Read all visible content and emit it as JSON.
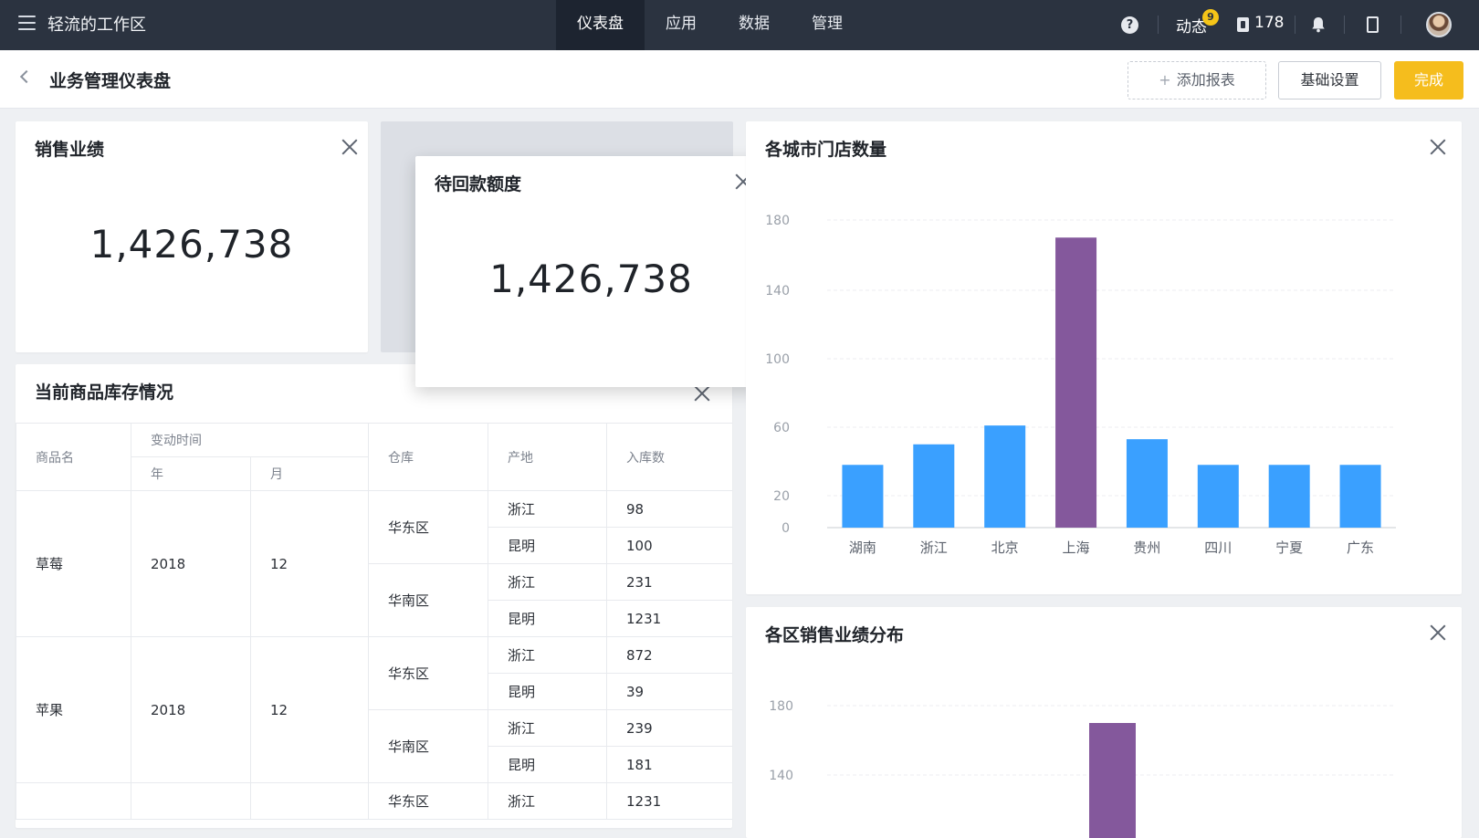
{
  "topbar": {
    "brand": "轻流的工作区",
    "nav": [
      "仪表盘",
      "应用",
      "数据",
      "管理"
    ],
    "dynamics_label": "动态",
    "dynamics_badge": "9",
    "count": "178",
    "help_glyph": "?"
  },
  "subheader": {
    "title": "业务管理仪表盘",
    "add_report": "添加报表",
    "add_plus": "+",
    "basic_settings": "基础设置",
    "done": "完成"
  },
  "sales_card": {
    "title": "销售业绩",
    "value": "1,426,738"
  },
  "receivable_card": {
    "title": "待回款额度",
    "value": "1,426,738"
  },
  "inventory": {
    "title": "当前商品库存情况",
    "headers": {
      "product": "商品名",
      "change_time": "变动时间",
      "year": "年",
      "month": "月",
      "warehouse": "仓库",
      "origin": "产地",
      "stock_in": "入库数"
    },
    "rows": [
      {
        "product": "草莓",
        "year": "2018",
        "month": "12",
        "warehouse": "华东区",
        "origin": "浙江",
        "qty": "98"
      },
      {
        "product": "",
        "year": "",
        "month": "",
        "warehouse": "",
        "origin": "昆明",
        "qty": "100"
      },
      {
        "product": "",
        "year": "",
        "month": "",
        "warehouse": "华南区",
        "origin": "浙江",
        "qty": "231"
      },
      {
        "product": "",
        "year": "",
        "month": "",
        "warehouse": "",
        "origin": "昆明",
        "qty": "1231"
      },
      {
        "product": "苹果",
        "year": "2018",
        "month": "12",
        "warehouse": "华东区",
        "origin": "浙江",
        "qty": "872"
      },
      {
        "product": "",
        "year": "",
        "month": "",
        "warehouse": "",
        "origin": "昆明",
        "qty": "39"
      },
      {
        "product": "",
        "year": "",
        "month": "",
        "warehouse": "华南区",
        "origin": "浙江",
        "qty": "239"
      },
      {
        "product": "",
        "year": "",
        "month": "",
        "warehouse": "",
        "origin": "昆明",
        "qty": "181"
      },
      {
        "product": "",
        "year": "",
        "month": "",
        "warehouse": "华东区",
        "origin": "浙江",
        "qty": "1231"
      }
    ]
  },
  "colors": {
    "bar": "#3aa0ff",
    "highlight": "#84589c",
    "accent": "#f5bd1d",
    "topbar": "#2b3340"
  },
  "chart_data": [
    {
      "type": "bar",
      "title": "各城市门店数量",
      "categories": [
        "湖南",
        "浙江",
        "北京",
        "上海",
        "贵州",
        "四川",
        "宁夏",
        "广东"
      ],
      "values": [
        38,
        50,
        61,
        170,
        53,
        38,
        38,
        38
      ],
      "highlight_index": 3,
      "yticks": [
        0,
        20,
        60,
        100,
        140,
        180
      ],
      "ylim": [
        0,
        180
      ],
      "grid": true
    },
    {
      "type": "bar",
      "title": "各区销售业绩分布",
      "categories": [],
      "visible_values": [
        170
      ],
      "highlight_index": 0,
      "yticks": [
        140,
        180
      ],
      "grid": true
    }
  ]
}
